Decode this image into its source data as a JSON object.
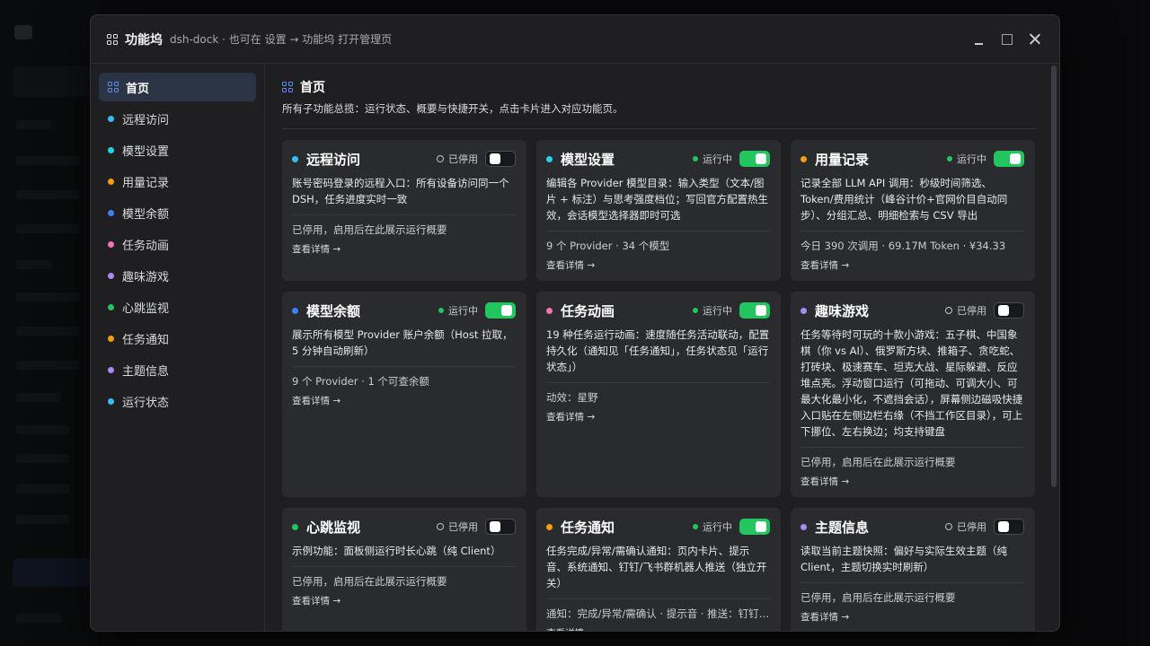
{
  "window": {
    "title": "功能坞",
    "subtitle": "dsh-dock · 也可在 设置 → 功能坞 打开管理页"
  },
  "sidebar": {
    "items": [
      {
        "label": "首页",
        "color": "",
        "active": true
      },
      {
        "label": "远程访问",
        "color": "#38bdf8"
      },
      {
        "label": "模型设置",
        "color": "#22d3ee"
      },
      {
        "label": "用量记录",
        "color": "#f59e0b"
      },
      {
        "label": "模型余额",
        "color": "#3b82f6"
      },
      {
        "label": "任务动画",
        "color": "#f472b6"
      },
      {
        "label": "趣味游戏",
        "color": "#a78bfa"
      },
      {
        "label": "心跳监视",
        "color": "#22c55e"
      },
      {
        "label": "任务通知",
        "color": "#f59e0b"
      },
      {
        "label": "主题信息",
        "color": "#a78bfa"
      },
      {
        "label": "运行状态",
        "color": "#38bdf8"
      }
    ]
  },
  "main": {
    "title": "首页",
    "description": "所有子功能总揽：运行状态、概要与快捷开关，点击卡片进入对应功能页。"
  },
  "status_labels": {
    "running": "运行中",
    "stopped": "已停用"
  },
  "link_label": "查看详情 →",
  "cards": [
    {
      "title": "远程访问",
      "color": "#38bdf8",
      "on": false,
      "status": "已停用",
      "desc": "账号密码登录的远程入口：所有设备访问同一个 DSH，任务进度实时一致",
      "summary": "已停用，启用后在此展示运行概要",
      "link": "查看详情 →"
    },
    {
      "title": "模型设置",
      "color": "#22d3ee",
      "on": true,
      "status": "运行中",
      "desc": "编辑各 Provider 模型目录：输入类型（文本/图片 + 标注）与思考强度档位；写回官方配置热生效，会话模型选择器即时可选",
      "summary": "9 个 Provider · 34 个模型",
      "link": "查看详情 →"
    },
    {
      "title": "用量记录",
      "color": "#f59e0b",
      "on": true,
      "status": "运行中",
      "desc": "记录全部 LLM API 调用：秒级时间筛选、Token/费用统计（峰谷计价+官网价目自动同步）、分组汇总、明细检索与 CSV 导出",
      "summary": "今日 390 次调用 · 69.17M Token · ¥34.33",
      "link": "查看详情 →"
    },
    {
      "title": "模型余额",
      "color": "#3b82f6",
      "on": true,
      "status": "运行中",
      "desc": "展示所有模型 Provider 账户余额（Host 拉取，5 分钟自动刷新）",
      "summary": "9 个 Provider · 1 个可查余额",
      "link": "查看详情 →"
    },
    {
      "title": "任务动画",
      "color": "#f472b6",
      "on": true,
      "status": "运行中",
      "desc": "19 种任务运行动画：速度随任务活动联动，配置持久化（通知见「任务通知」，任务状态见「运行状态」）",
      "summary": "动效：星野",
      "link": "查看详情 →"
    },
    {
      "title": "趣味游戏",
      "color": "#a78bfa",
      "on": false,
      "status": "已停用",
      "desc": "任务等待时可玩的十款小游戏：五子棋、中国象棋（你 vs AI）、俄罗斯方块、推箱子、贪吃蛇、打砖块、极速赛车、坦克大战、星际躲避、反应堆点亮。浮动窗口运行（可拖动、可调大小、可最大化最小化，不遮挡会话），屏幕侧边磁吸快捷入口贴在左侧边栏右缘（不挡工作区目录），可上下挪位、左右换边；均支持键盘",
      "summary": "已停用，启用后在此展示运行概要",
      "link": "查看详情 →"
    },
    {
      "title": "心跳监视",
      "color": "#22c55e",
      "on": false,
      "status": "已停用",
      "desc": "示例功能：面板侧运行时长心跳（纯 Client）",
      "summary": "已停用，启用后在此展示运行概要",
      "link": "查看详情 →"
    },
    {
      "title": "任务通知",
      "color": "#f59e0b",
      "on": true,
      "status": "运行中",
      "desc": "任务完成/异常/需确认通知：页内卡片、提示音、系统通知、钉钉/飞书群机器人推送（独立开关）",
      "summary": "通知：完成/异常/需确认 · 提示音 · 推送：钉钉/飞书",
      "link": "查看详情 →"
    },
    {
      "title": "主题信息",
      "color": "#a78bfa",
      "on": false,
      "status": "已停用",
      "desc": "读取当前主题快照：偏好与实际生效主题（纯 Client，主题切换实时刷新）",
      "summary": "已停用，启用后在此展示运行概要",
      "link": "查看详情 →"
    }
  ],
  "icons": {
    "window_icon": "grid-icon",
    "home_icon": "grid-icon",
    "minimize": "minimize-icon",
    "maximize": "maximize-icon",
    "close": "close-icon"
  }
}
